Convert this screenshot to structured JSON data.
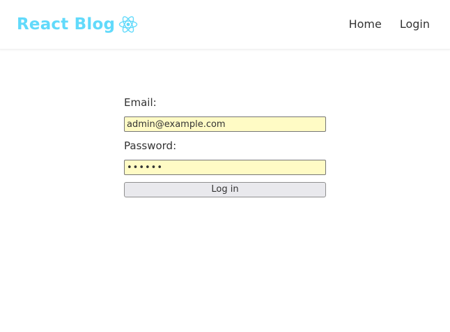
{
  "navbar": {
    "brand_label": "React Blog",
    "brand_icon": "react-logo-icon",
    "links": [
      {
        "label": "Home"
      },
      {
        "label": "Login"
      }
    ]
  },
  "login_form": {
    "email_label": "Email:",
    "email_value": "admin@example.com",
    "password_label": "Password:",
    "password_value": "••••••",
    "submit_label": "Log in"
  },
  "colors": {
    "brand": "#61dafb",
    "autofill_background": "#fffbc5",
    "button_background": "#e9e9ed",
    "text": "#333333"
  }
}
